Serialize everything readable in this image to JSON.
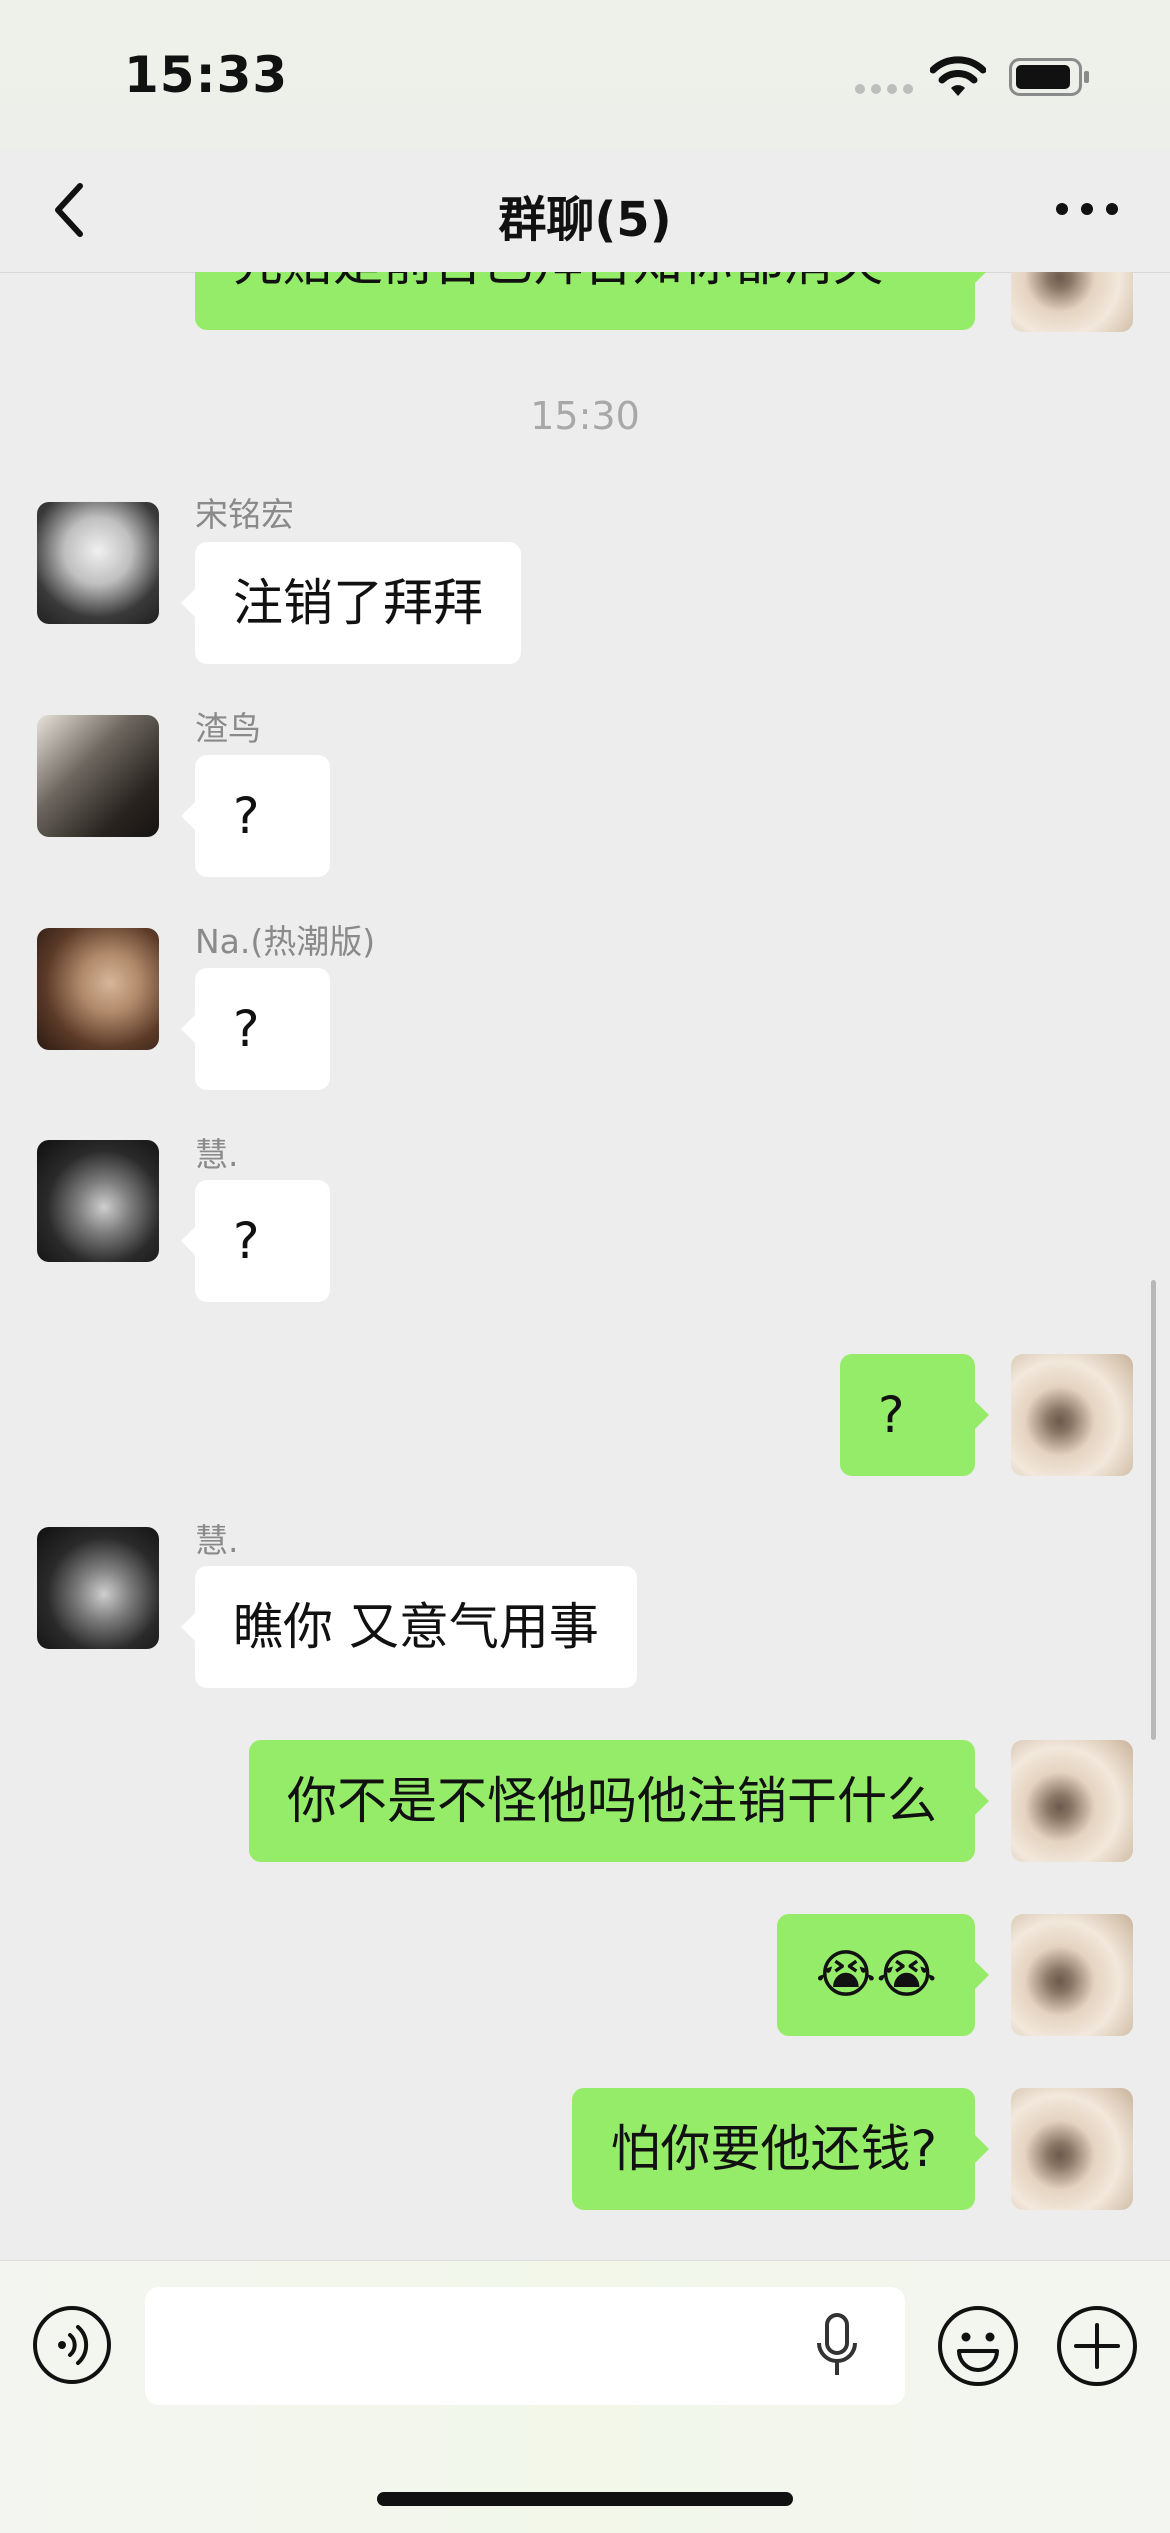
{
  "status_bar": {
    "time": "15:33",
    "icons": [
      "cellular-dots-icon",
      "wifi-icon",
      "battery-icon"
    ]
  },
  "nav": {
    "title": "群聊(5)",
    "back_icon": "chevron-left-icon",
    "more_icon": "more-dots-icon"
  },
  "chat": {
    "top_partial_message": "先赔是前台已拜告知你都消失",
    "time_divider": "15:30",
    "messages": [
      {
        "side": "in",
        "sender": "宋铭宏",
        "avatar": "anime-avatar",
        "text": "注销了拜拜"
      },
      {
        "side": "in",
        "sender": "渣鸟",
        "avatar": "dark-photo-avatar",
        "text": "?"
      },
      {
        "side": "in",
        "sender": "Na.(热潮版)",
        "avatar": "boy-photo-avatar",
        "text": "?"
      },
      {
        "side": "in",
        "sender": "慧.",
        "avatar": "girl-photo-avatar",
        "text": "?"
      },
      {
        "side": "out",
        "sender": "",
        "avatar": "puppy-avatar",
        "text": "?"
      },
      {
        "side": "in",
        "sender": "慧.",
        "avatar": "girl-photo-avatar",
        "text": "瞧你 又意气用事"
      },
      {
        "side": "out",
        "sender": "",
        "avatar": "puppy-avatar",
        "text": "你不是不怪他吗他注销干什么"
      },
      {
        "side": "out",
        "sender": "",
        "avatar": "puppy-avatar",
        "text": "😭😭"
      },
      {
        "side": "out",
        "sender": "",
        "avatar": "puppy-avatar",
        "text": "怕你要他还钱?"
      }
    ]
  },
  "input_bar": {
    "voice_icon": "voice-mode-icon",
    "input_value": "",
    "mic_icon": "microphone-icon",
    "emoji_icon": "smiley-face-icon",
    "plus_icon": "plus-circle-icon"
  },
  "colors": {
    "outgoing_bubble": "#95ec69",
    "incoming_bubble": "#ffffff",
    "background": "#ededed"
  }
}
